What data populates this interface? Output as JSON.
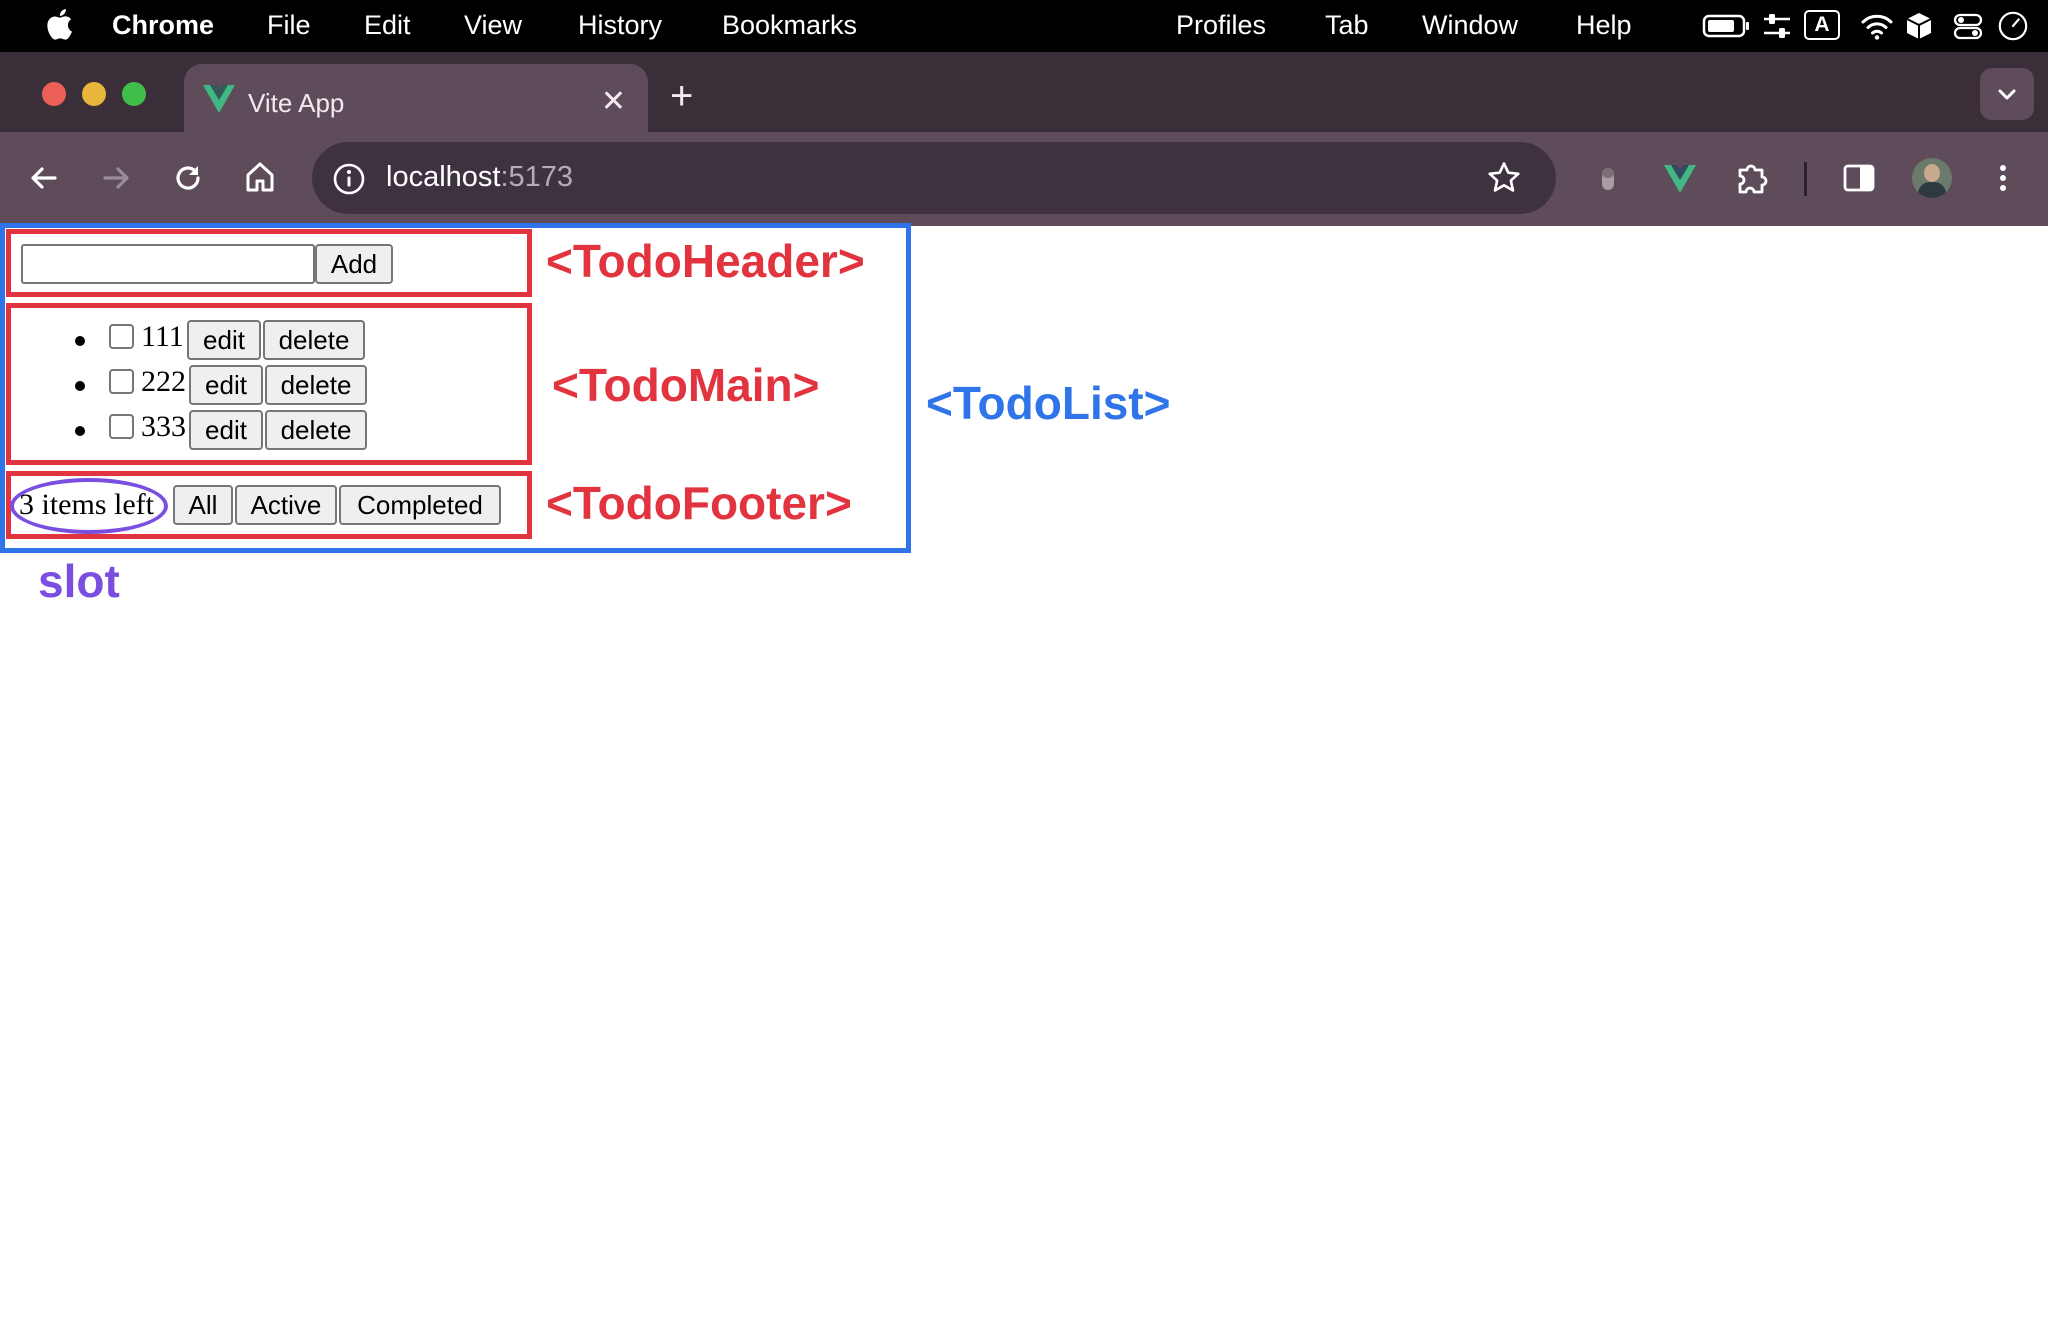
{
  "menubar": {
    "app_name": "Chrome",
    "items": [
      "File",
      "Edit",
      "View",
      "History",
      "Bookmarks"
    ],
    "right_items": [
      "Profiles",
      "Tab",
      "Window",
      "Help"
    ],
    "input_source_label": "A"
  },
  "browser": {
    "tab_title": "Vite App",
    "address_host": "localhost",
    "address_port": ":5173"
  },
  "todo_header": {
    "input_value": "",
    "add_label": "Add"
  },
  "todo_main": {
    "items": [
      {
        "text": "111",
        "checked": false
      },
      {
        "text": "222",
        "checked": false
      },
      {
        "text": "333",
        "checked": false
      }
    ],
    "edit_label": "edit",
    "delete_label": "delete"
  },
  "todo_footer": {
    "items_left": "3 items left",
    "filters": [
      "All",
      "Active",
      "Completed"
    ]
  },
  "annotations": {
    "todo_header": "<TodoHeader>",
    "todo_main": "<TodoMain>",
    "todo_footer": "<TodoFooter>",
    "todo_list": "<TodoList>",
    "slot": "slot"
  },
  "colors": {
    "component_red": "#e1343f",
    "component_blue": "#2f74e8",
    "slot_purple": "#7a4fe0",
    "chrome_frame": "#3a2f39",
    "chrome_toolbar": "#5e4c5b",
    "vue_green": "#41b883"
  },
  "icons": {
    "menubar": [
      "apple-icon",
      "battery-icon",
      "control-sliders-icon",
      "input-source-icon",
      "wifi-icon",
      "cube-icon",
      "control-center-icon",
      "clock-icon"
    ],
    "toolbar": [
      "back-arrow-icon",
      "forward-arrow-icon",
      "reload-icon",
      "home-icon",
      "site-info-icon",
      "star-icon",
      "extension-icon",
      "vue-devtools-icon",
      "puzzle-icon",
      "side-panel-icon",
      "avatar",
      "kebab-menu-icon"
    ]
  }
}
